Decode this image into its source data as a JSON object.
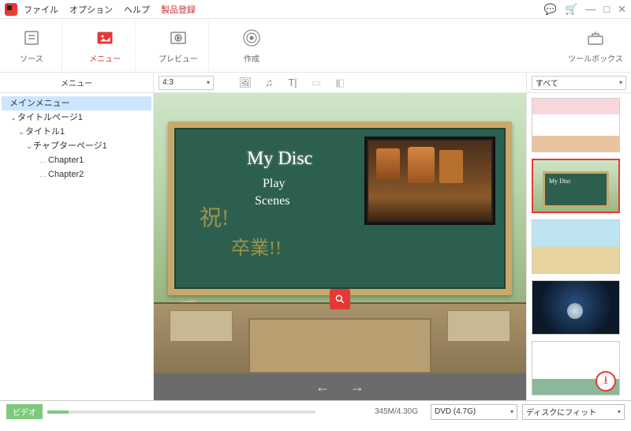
{
  "menubar": {
    "file": "ファイル",
    "option": "オプション",
    "help": "ヘルプ",
    "register": "製品登録"
  },
  "steps": {
    "source": "ソース",
    "menu": "メニュー",
    "preview": "プレビュー",
    "create": "作成"
  },
  "toolbox": {
    "label": "ツールボックス"
  },
  "leftpanel": {
    "header": "メニュー",
    "tree": {
      "main": "メインメニュー",
      "titlepage": "タイトルページ1",
      "title": "タイトル1",
      "chapterpage": "チャプターページ1",
      "chapter1": "Chapter1",
      "chapter2": "Chapter2"
    }
  },
  "center": {
    "aspect": "4:3",
    "disc_title": "My Disc",
    "play": "Play",
    "scenes": "Scenes",
    "deco1": "祝!",
    "deco2": "卒業!!"
  },
  "rightpanel": {
    "filter": "すべて",
    "tpl2_title": "My Disc"
  },
  "statusbar": {
    "video": "ビデオ",
    "size": "345M/4.30G",
    "disc": "DVD (4.7G)",
    "fit": "ディスクにフィット"
  }
}
